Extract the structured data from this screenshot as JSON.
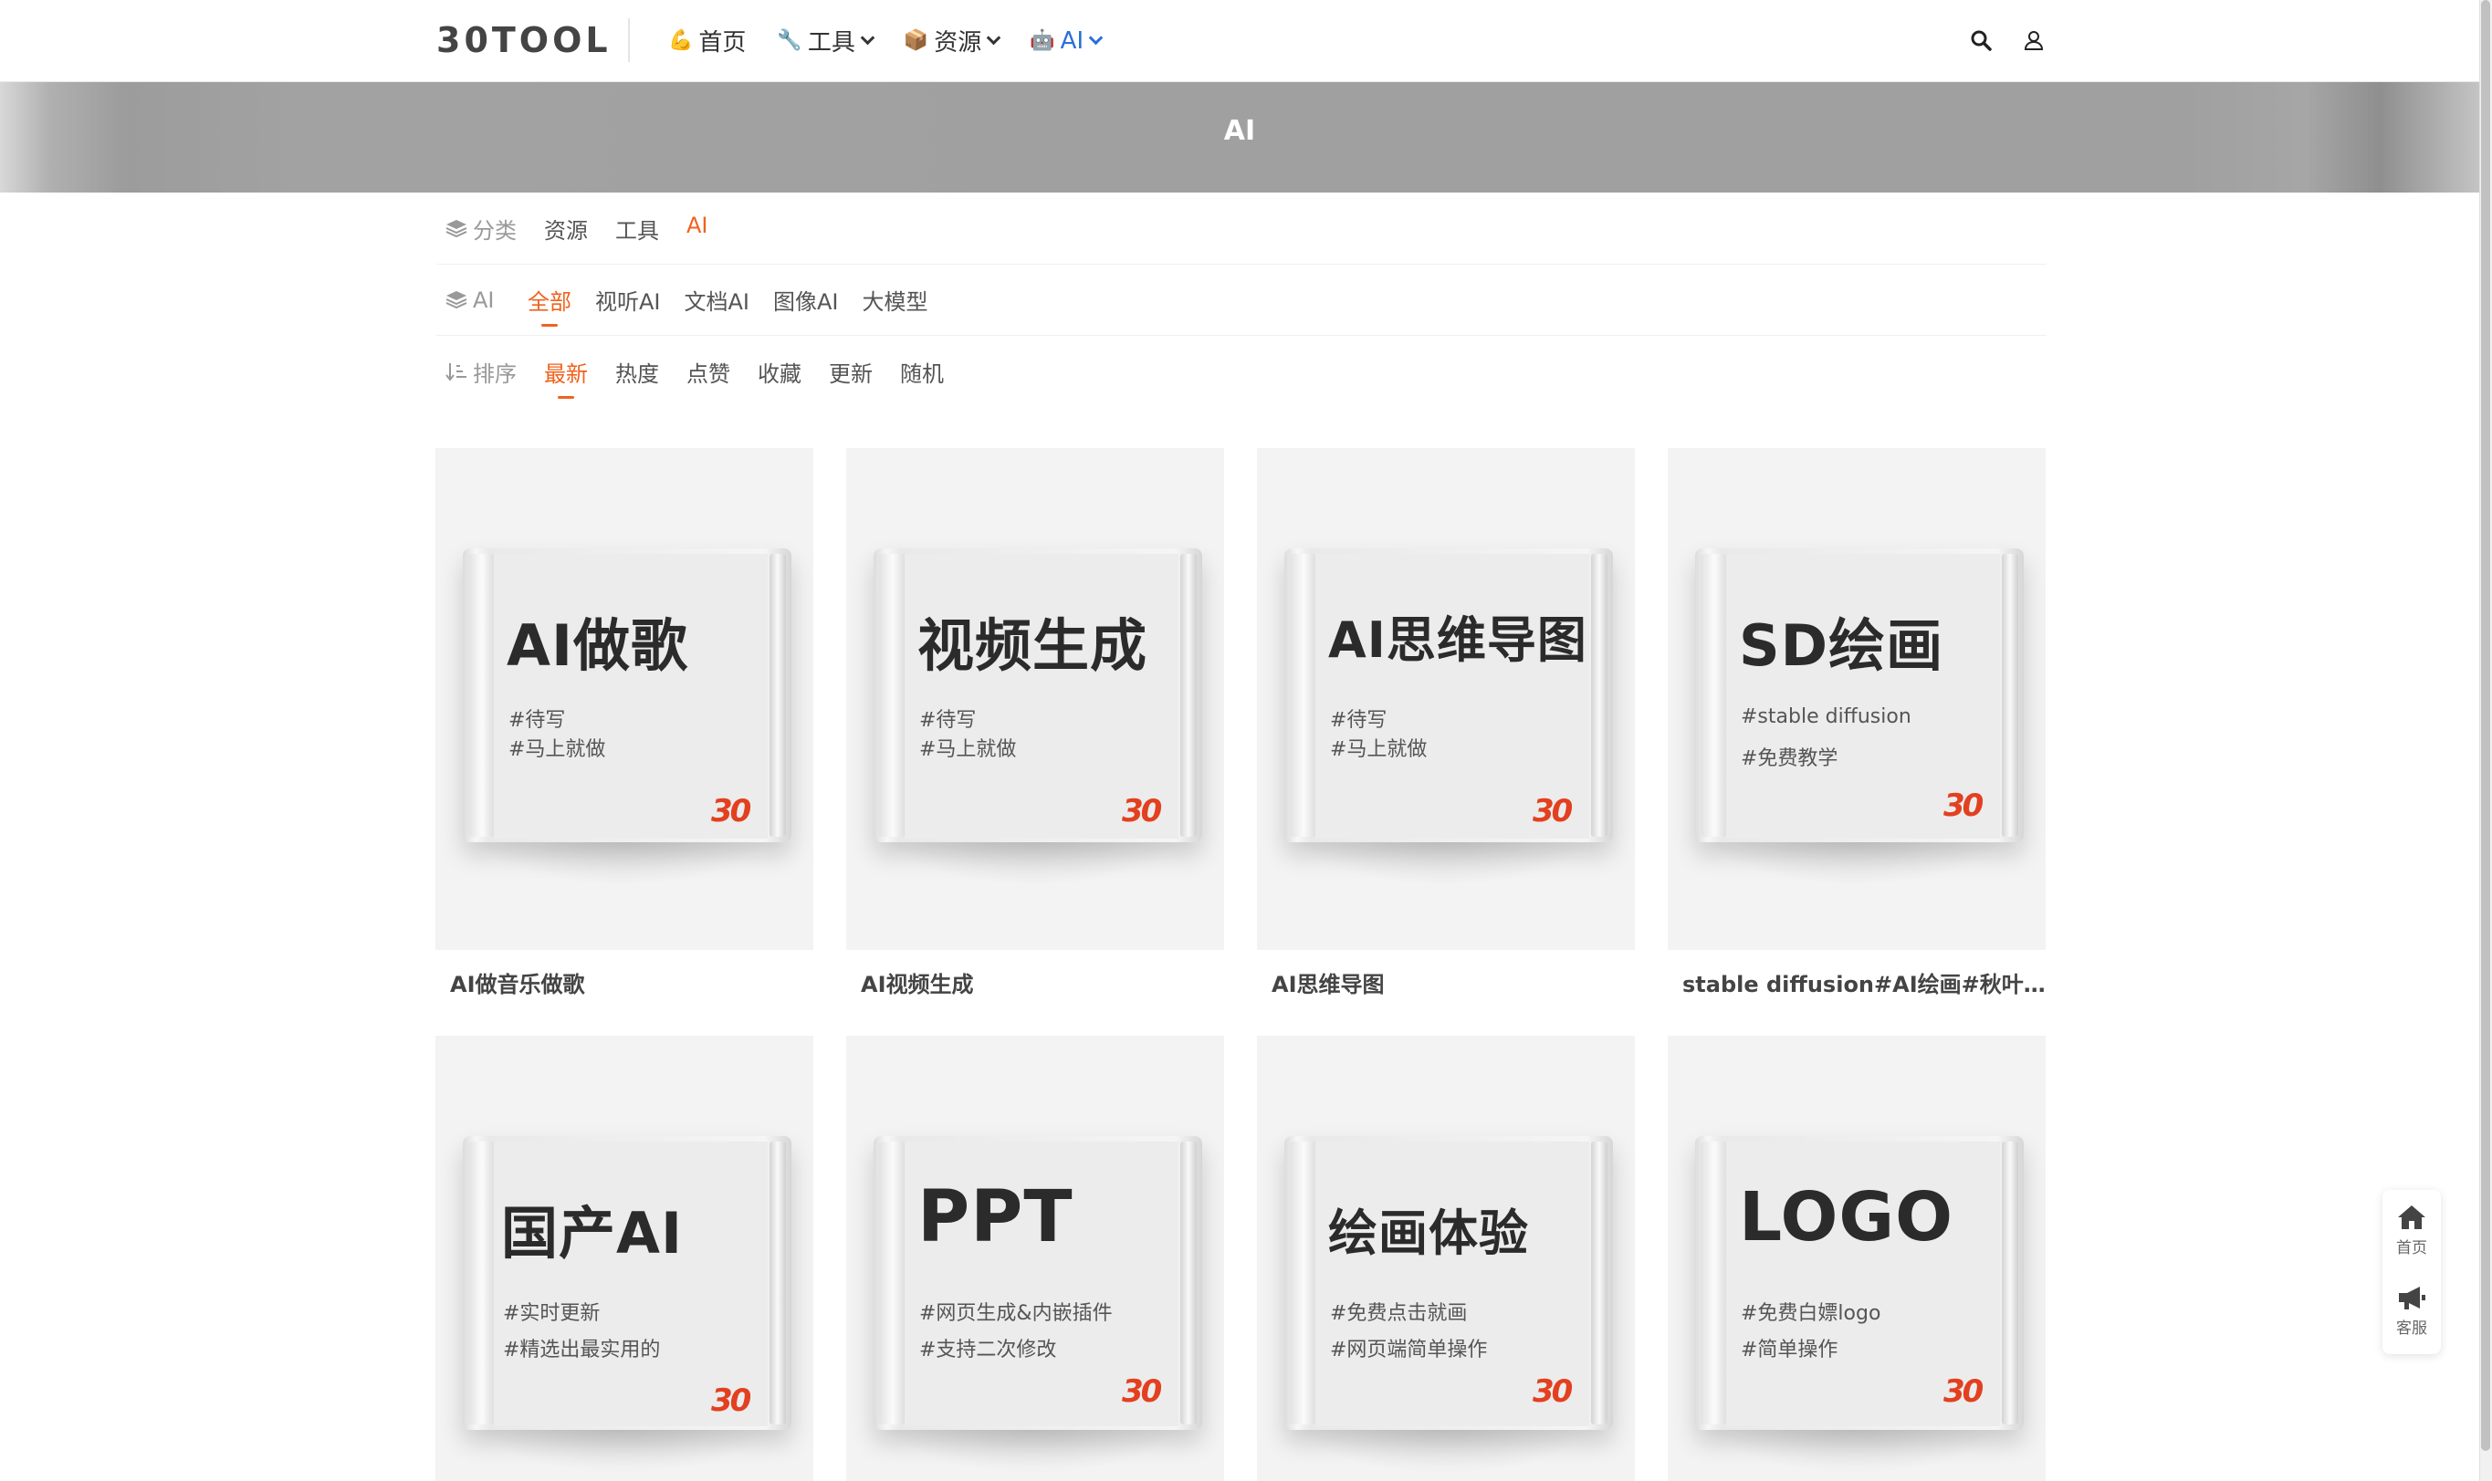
{
  "header": {
    "logo": "30TOOL",
    "nav": [
      {
        "icon": "hand-icon",
        "glyph": "💪",
        "label": "首页",
        "caret": false
      },
      {
        "icon": "wrench-icon",
        "glyph": "🔧",
        "label": "工具",
        "caret": true
      },
      {
        "icon": "package-icon",
        "glyph": "📦",
        "label": "资源",
        "caret": true
      },
      {
        "icon": "robot-icon",
        "glyph": "🤖",
        "label": "AI",
        "caret": true
      }
    ]
  },
  "banner": {
    "title": "AI"
  },
  "filters": {
    "category": {
      "label": "分类",
      "options": [
        "资源",
        "工具",
        "AI"
      ],
      "active": "AI"
    },
    "ai": {
      "label": "AI",
      "options": [
        "全部",
        "视听AI",
        "文档AI",
        "图像AI",
        "大模型"
      ],
      "active": "全部"
    },
    "sort": {
      "label": "排序",
      "options": [
        "最新",
        "热度",
        "点赞",
        "收藏",
        "更新",
        "随机"
      ],
      "active": "最新"
    }
  },
  "cards": [
    {
      "cover": "AI做歌",
      "tags": [
        "#待写",
        "#马上就做"
      ],
      "title": "AI做音乐做歌"
    },
    {
      "cover": "视频生成",
      "tags": [
        "#待写",
        "#马上就做"
      ],
      "title": "AI视频生成"
    },
    {
      "cover": "AI思维导图",
      "tags": [
        "#待写",
        "#马上就做"
      ],
      "title": "AI思维导图"
    },
    {
      "cover": "SD绘画",
      "tags": [
        "#stable diffusion",
        "#免费教学"
      ],
      "title": "stable diffusion#AI绘画#秋叶大..."
    },
    {
      "cover": "国产AI",
      "tags": [
        "#实时更新",
        "#精选出最实用的"
      ],
      "title": ""
    },
    {
      "cover": "PPT",
      "tags": [
        "#网页生成&内嵌插件",
        "#支持二次修改"
      ],
      "title": ""
    },
    {
      "cover": "绘画体验",
      "tags": [
        "#免费点击就画",
        "#网页端简单操作"
      ],
      "title": ""
    },
    {
      "cover": "LOGO",
      "tags": [
        "#免费白嫖logo",
        "#简单操作"
      ],
      "title": ""
    }
  ],
  "cover_mark": "30",
  "float": {
    "home": "首页",
    "service": "客服"
  },
  "colors": {
    "accent": "#f0621e",
    "nav_active": "#2a6fd6",
    "mark": "#e2401f"
  }
}
